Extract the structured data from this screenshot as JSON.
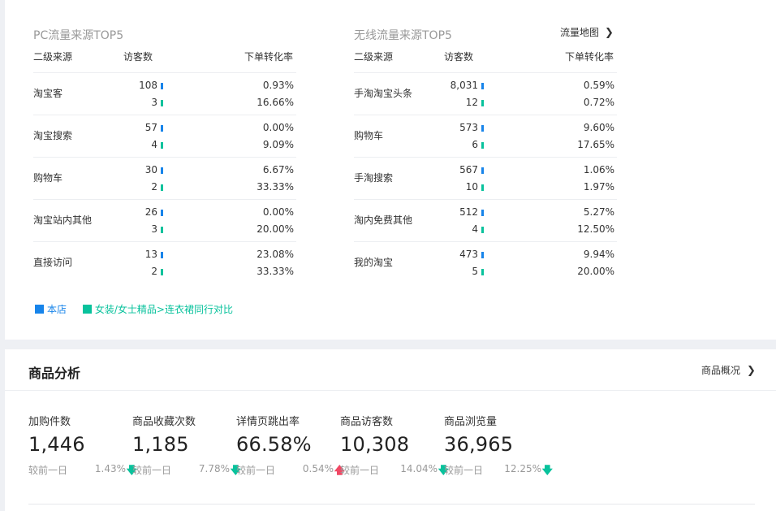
{
  "pc": {
    "title": "PC流量来源TOP5",
    "col_source": "二级来源",
    "col_visitors": "访客数",
    "col_conversion": "下单转化率",
    "rows": [
      {
        "name": "淘宝客",
        "v1": "108",
        "v2": "3",
        "c1": "0.93%",
        "c2": "16.66%"
      },
      {
        "name": "淘宝搜索",
        "v1": "57",
        "v2": "4",
        "c1": "0.00%",
        "c2": "9.09%"
      },
      {
        "name": "购物车",
        "v1": "30",
        "v2": "2",
        "c1": "6.67%",
        "c2": "33.33%"
      },
      {
        "name": "淘宝站内其他",
        "v1": "26",
        "v2": "3",
        "c1": "0.00%",
        "c2": "20.00%"
      },
      {
        "name": "直接访问",
        "v1": "13",
        "v2": "2",
        "c1": "23.08%",
        "c2": "33.33%"
      }
    ]
  },
  "wireless": {
    "title": "无线流量来源TOP5",
    "map_link": "流量地图",
    "col_source": "二级来源",
    "col_visitors": "访客数",
    "col_conversion": "下单转化率",
    "rows": [
      {
        "name": "手淘淘宝头条",
        "v1": "8,031",
        "v2": "12",
        "c1": "0.59%",
        "c2": "0.72%"
      },
      {
        "name": "购物车",
        "v1": "573",
        "v2": "6",
        "c1": "9.60%",
        "c2": "17.65%"
      },
      {
        "name": "手淘搜索",
        "v1": "567",
        "v2": "10",
        "c1": "1.06%",
        "c2": "1.97%"
      },
      {
        "name": "淘内免费其他",
        "v1": "512",
        "v2": "4",
        "c1": "5.27%",
        "c2": "12.50%"
      },
      {
        "name": "我的淘宝",
        "v1": "473",
        "v2": "5",
        "c1": "9.94%",
        "c2": "20.00%"
      }
    ]
  },
  "legend": {
    "shop": "本店",
    "peer": "女装/女士精品>连衣裙同行对比"
  },
  "colors": {
    "shop": "#1784ea",
    "peer": "#08c29c",
    "down_arrow": "#08c29c",
    "up_arrow": "#f04864"
  },
  "product": {
    "title": "商品分析",
    "overview_link": "商品概况",
    "metrics": [
      {
        "label": "加购件数",
        "value": "1,446",
        "compare_label": "较前一日",
        "compare_value": "1.43%",
        "trend": "down"
      },
      {
        "label": "商品收藏次数",
        "value": "1,185",
        "compare_label": "较前一日",
        "compare_value": "7.78%",
        "trend": "down"
      },
      {
        "label": "详情页跳出率",
        "value": "66.58%",
        "compare_label": "较前一日",
        "compare_value": "0.54%",
        "trend": "up"
      },
      {
        "label": "商品访客数",
        "value": "10,308",
        "compare_label": "较前一日",
        "compare_value": "14.04%",
        "trend": "down"
      },
      {
        "label": "商品浏览量",
        "value": "36,965",
        "compare_label": "较前一日",
        "compare_value": "12.25%",
        "trend": "down"
      }
    ]
  }
}
